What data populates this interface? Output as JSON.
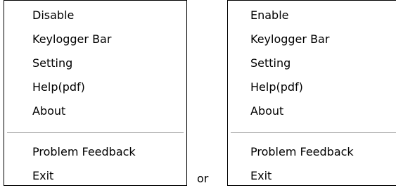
{
  "left_menu": {
    "items": [
      {
        "label": "Disable"
      },
      {
        "label": "Keylogger Bar"
      },
      {
        "label": "Setting"
      },
      {
        "label": "Help(pdf)"
      },
      {
        "label": "About"
      }
    ],
    "footer_items": [
      {
        "label": "Problem Feedback"
      },
      {
        "label": "Exit"
      }
    ]
  },
  "connector": {
    "text": "or"
  },
  "right_menu": {
    "items": [
      {
        "label": "Enable"
      },
      {
        "label": "Keylogger Bar"
      },
      {
        "label": "Setting"
      },
      {
        "label": "Help(pdf)"
      },
      {
        "label": "About"
      }
    ],
    "footer_items": [
      {
        "label": "Problem Feedback"
      },
      {
        "label": "Exit"
      }
    ]
  }
}
